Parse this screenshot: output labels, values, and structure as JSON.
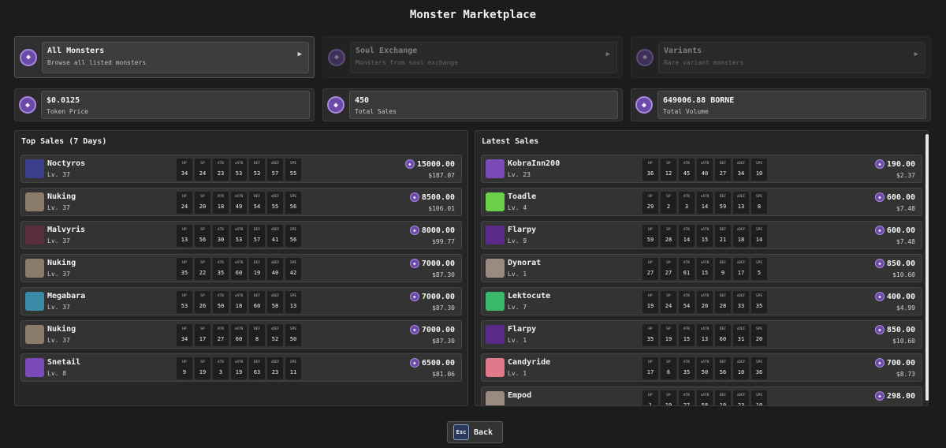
{
  "title": "Monster Marketplace",
  "tabs": [
    {
      "label": "All Monsters",
      "sub": "Browse all listed monsters",
      "active": true
    },
    {
      "label": "Soul Exchange",
      "sub": "Monsters from soul exchange",
      "active": false
    },
    {
      "label": "Variants",
      "sub": "Rare variant monsters",
      "active": false
    }
  ],
  "stats": [
    {
      "value": "$0.0125",
      "label": "Token Price"
    },
    {
      "value": "450",
      "label": "Total Sales"
    },
    {
      "value": "649006.88 BORNE",
      "label": "Total Volume"
    }
  ],
  "stat_labels": [
    "HP",
    "SP",
    "ATK",
    "sATK",
    "DEF",
    "sDEF",
    "SPE"
  ],
  "top_sales": {
    "title": "Top Sales (7 Days)",
    "rows": [
      {
        "name": "Noctyros",
        "level": "Lv. 37",
        "stats": [
          "34",
          "24",
          "23",
          "53",
          "53",
          "57",
          "55"
        ],
        "price": "15000.00",
        "usd": "$187.07",
        "color": "#3a3f8c"
      },
      {
        "name": "Nuking",
        "level": "Lv. 37",
        "stats": [
          "24",
          "20",
          "18",
          "49",
          "54",
          "55",
          "56"
        ],
        "price": "8500.00",
        "usd": "$106.01",
        "color": "#8a7b6a"
      },
      {
        "name": "Malvyris",
        "level": "Lv. 37",
        "stats": [
          "13",
          "56",
          "30",
          "53",
          "57",
          "41",
          "56"
        ],
        "price": "8000.00",
        "usd": "$99.77",
        "color": "#5a2e3a"
      },
      {
        "name": "Nuking",
        "level": "Lv. 37",
        "stats": [
          "35",
          "22",
          "35",
          "60",
          "19",
          "40",
          "42"
        ],
        "price": "7000.00",
        "usd": "$87.30",
        "color": "#8a7b6a"
      },
      {
        "name": "Megabara",
        "level": "Lv. 37",
        "stats": [
          "53",
          "26",
          "50",
          "18",
          "60",
          "58",
          "13"
        ],
        "price": "7000.00",
        "usd": "$87.30",
        "color": "#3a8aa8"
      },
      {
        "name": "Nuking",
        "level": "Lv. 37",
        "stats": [
          "34",
          "17",
          "27",
          "60",
          "8",
          "52",
          "50"
        ],
        "price": "7000.00",
        "usd": "$87.30",
        "color": "#8a7b6a"
      },
      {
        "name": "Snetail",
        "level": "Lv. 8",
        "stats": [
          "9",
          "19",
          "3",
          "19",
          "63",
          "23",
          "11"
        ],
        "price": "6500.00",
        "usd": "$81.06",
        "color": "#7a4ab8"
      }
    ]
  },
  "latest_sales": {
    "title": "Latest Sales",
    "rows": [
      {
        "name": "KobraInn200",
        "level": "Lv. 23",
        "stats": [
          "36",
          "12",
          "45",
          "40",
          "27",
          "34",
          "10"
        ],
        "price": "190.00",
        "usd": "$2.37",
        "color": "#7a4ab8"
      },
      {
        "name": "Toadle",
        "level": "Lv. 4",
        "stats": [
          "29",
          "2",
          "3",
          "14",
          "59",
          "13",
          "8"
        ],
        "price": "600.00",
        "usd": "$7.48",
        "color": "#6ad04a"
      },
      {
        "name": "Flarpy",
        "level": "Lv. 9",
        "stats": [
          "59",
          "28",
          "14",
          "15",
          "21",
          "18",
          "14"
        ],
        "price": "600.00",
        "usd": "$7.48",
        "color": "#5a2a8a"
      },
      {
        "name": "Dynorat",
        "level": "Lv. 1",
        "stats": [
          "27",
          "27",
          "61",
          "15",
          "9",
          "17",
          "5"
        ],
        "price": "850.00",
        "usd": "$10.60",
        "color": "#9a8a80"
      },
      {
        "name": "Lektocute",
        "level": "Lv. 7",
        "stats": [
          "19",
          "24",
          "54",
          "20",
          "28",
          "33",
          "35"
        ],
        "price": "400.00",
        "usd": "$4.99",
        "color": "#3ab86a"
      },
      {
        "name": "Flarpy",
        "level": "Lv. 1",
        "stats": [
          "35",
          "19",
          "15",
          "13",
          "60",
          "31",
          "20"
        ],
        "price": "850.00",
        "usd": "$10.60",
        "color": "#5a2a8a"
      },
      {
        "name": "Candyride",
        "level": "Lv. 1",
        "stats": [
          "17",
          "6",
          "35",
          "50",
          "56",
          "10",
          "36"
        ],
        "price": "700.00",
        "usd": "$8.73",
        "color": "#e07a8a"
      },
      {
        "name": "Empod",
        "level": "",
        "stats": [
          "1",
          "19",
          "27",
          "58",
          "10",
          "23",
          "10"
        ],
        "price": "298.00",
        "usd": "",
        "color": "#9a8a80"
      }
    ]
  },
  "back": {
    "key": "Esc",
    "label": "Back"
  },
  "token_icon": "borne-coin-icon"
}
